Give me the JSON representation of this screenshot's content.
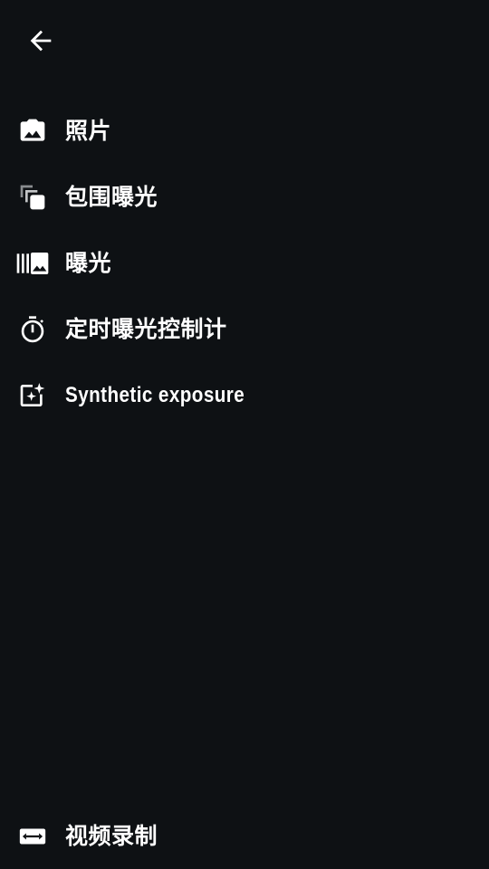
{
  "nav": {
    "back_icon": "arrow-back-icon"
  },
  "menu": {
    "items": [
      {
        "label": "照片",
        "icon": "photo-camera-icon"
      },
      {
        "label": "包围曝光",
        "icon": "bracket-stack-icon"
      },
      {
        "label": "曝光",
        "icon": "exposure-strip-icon"
      },
      {
        "label": "定时曝光控制计",
        "icon": "timer-icon"
      },
      {
        "label": "Synthetic exposure",
        "icon": "sparkle-frame-icon"
      }
    ]
  },
  "footer": {
    "video": {
      "label": "视频录制",
      "icon": "video-camera-icon"
    }
  },
  "colors": {
    "background": "#0e1114",
    "foreground": "#ffffff"
  }
}
